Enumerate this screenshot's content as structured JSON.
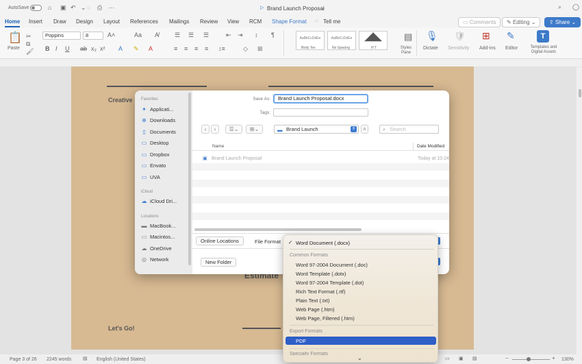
{
  "titlebar": {
    "autosave": "AutoSave",
    "doc_title": "Brand Launch Proposal"
  },
  "tabs": [
    "Home",
    "Insert",
    "Draw",
    "Design",
    "Layout",
    "References",
    "Mailings",
    "Review",
    "View",
    "RCM",
    "Shape Format",
    "Tell me"
  ],
  "header_buttons": {
    "comments": "Comments",
    "editing": "Editing",
    "share": "Share"
  },
  "ribbon": {
    "paste": "Paste",
    "font_name": "Poppins",
    "font_size": "8",
    "styles": [
      {
        "preview": "AaBbCcDdEe",
        "label": "Body Tex"
      },
      {
        "preview": "AaBbCcDdEe",
        "label": "No Spacing"
      },
      {
        "preview": "",
        "label": "H T"
      }
    ],
    "styles_pane": "Styles Pane",
    "dictate": "Dictate",
    "sensitivity": "Sensitivity",
    "addins": "Add-ins",
    "editor": "Editor",
    "templates": "Templates and Digital Assets"
  },
  "page": {
    "left_heading": "Creative",
    "mid_heading": "Estimate",
    "bottom_heading": "Let's Go!"
  },
  "dialog": {
    "save_as_label": "Save As:",
    "save_as_value": "Brand Launch Proposal.docx",
    "tags_label": "Tags:",
    "location": "Brand Launch",
    "search_placeholder": "Search",
    "col_name": "Name",
    "col_date": "Date Modified",
    "file_name": "Brand Launch Proposal",
    "file_date": "Today at 10:24",
    "online_locations": "Online Locations",
    "file_format_label": "File Format",
    "new_folder": "New Folder",
    "sidebar": {
      "favorites": "Favorites",
      "fav_items": [
        {
          "label": "Applicati...",
          "icon": "apps-icon"
        },
        {
          "label": "Downloads",
          "icon": "download-icon"
        },
        {
          "label": "Documents",
          "icon": "document-icon"
        },
        {
          "label": "Desktop",
          "icon": "desktop-icon"
        },
        {
          "label": "Dropbox",
          "icon": "folder-icon"
        },
        {
          "label": "Envato",
          "icon": "folder-icon"
        },
        {
          "label": "UVA",
          "icon": "folder-icon"
        }
      ],
      "icloud": "iCloud",
      "icloud_drive": "iCloud Dri...",
      "locations": "Locations",
      "loc_items": [
        {
          "label": "MacBook...",
          "icon": "laptop-icon"
        },
        {
          "label": "Macintos...",
          "icon": "disk-icon"
        },
        {
          "label": "OneDrive",
          "icon": "cloud-icon"
        },
        {
          "label": "Network",
          "icon": "network-icon"
        }
      ]
    }
  },
  "format_menu": {
    "selected": "Word Document (.docx)",
    "common_header": "Common Formats",
    "common": [
      "Word 97-2004 Document (.doc)",
      "Word Template (.dotx)",
      "Word 97-2004 Template (.dot)",
      "Rich Text Format (.rtf)",
      "Plain Text (.txt)",
      "Web Page (.htm)",
      "Web Page, Filtered (.htm)"
    ],
    "export_header": "Export Formats",
    "highlighted": "PDF",
    "specialty_header": "Specialty Formats"
  },
  "status": {
    "page": "Page 3 of 26",
    "words": "2245 words",
    "language": "English (United States)",
    "zoom": "130%"
  },
  "colors": {
    "accent": "#1b5fb5",
    "page": "#d7b992",
    "highlight": "#2e5ec7"
  }
}
